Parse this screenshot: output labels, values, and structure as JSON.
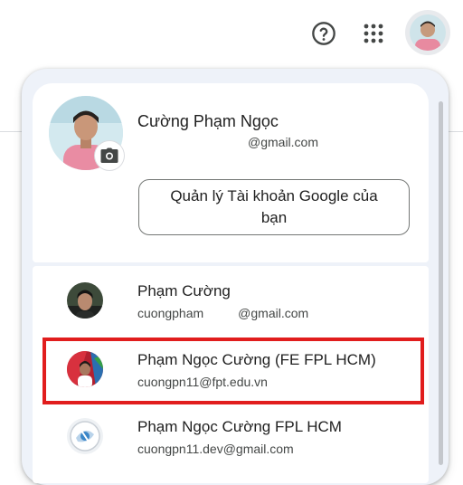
{
  "topbar": {
    "help_icon": "help-circle-icon",
    "apps_icon": "apps-grid-icon",
    "avatar": "profile-avatar"
  },
  "current_account": {
    "name": "Cường Phạm Ngọc",
    "email": "@gmail.com",
    "camera_icon": "camera-icon",
    "manage_label_line1": "Quản lý Tài khoản Google của",
    "manage_label_line2": "bạn"
  },
  "accounts": [
    {
      "name": "Phạm Cường",
      "email_user": "cuongpham",
      "email_domain": "@gmail.com"
    },
    {
      "name": "Phạm Ngọc Cường (FE FPL HCM)",
      "email": "cuongpn11@fpt.edu.vn",
      "highlighted": true
    },
    {
      "name": "Phạm Ngọc Cường FPL HCM",
      "email": "cuongpn11.dev@gmail.com"
    }
  ],
  "colors": {
    "highlight": "#e11d1d",
    "panel_bg": "#eef2f9"
  }
}
